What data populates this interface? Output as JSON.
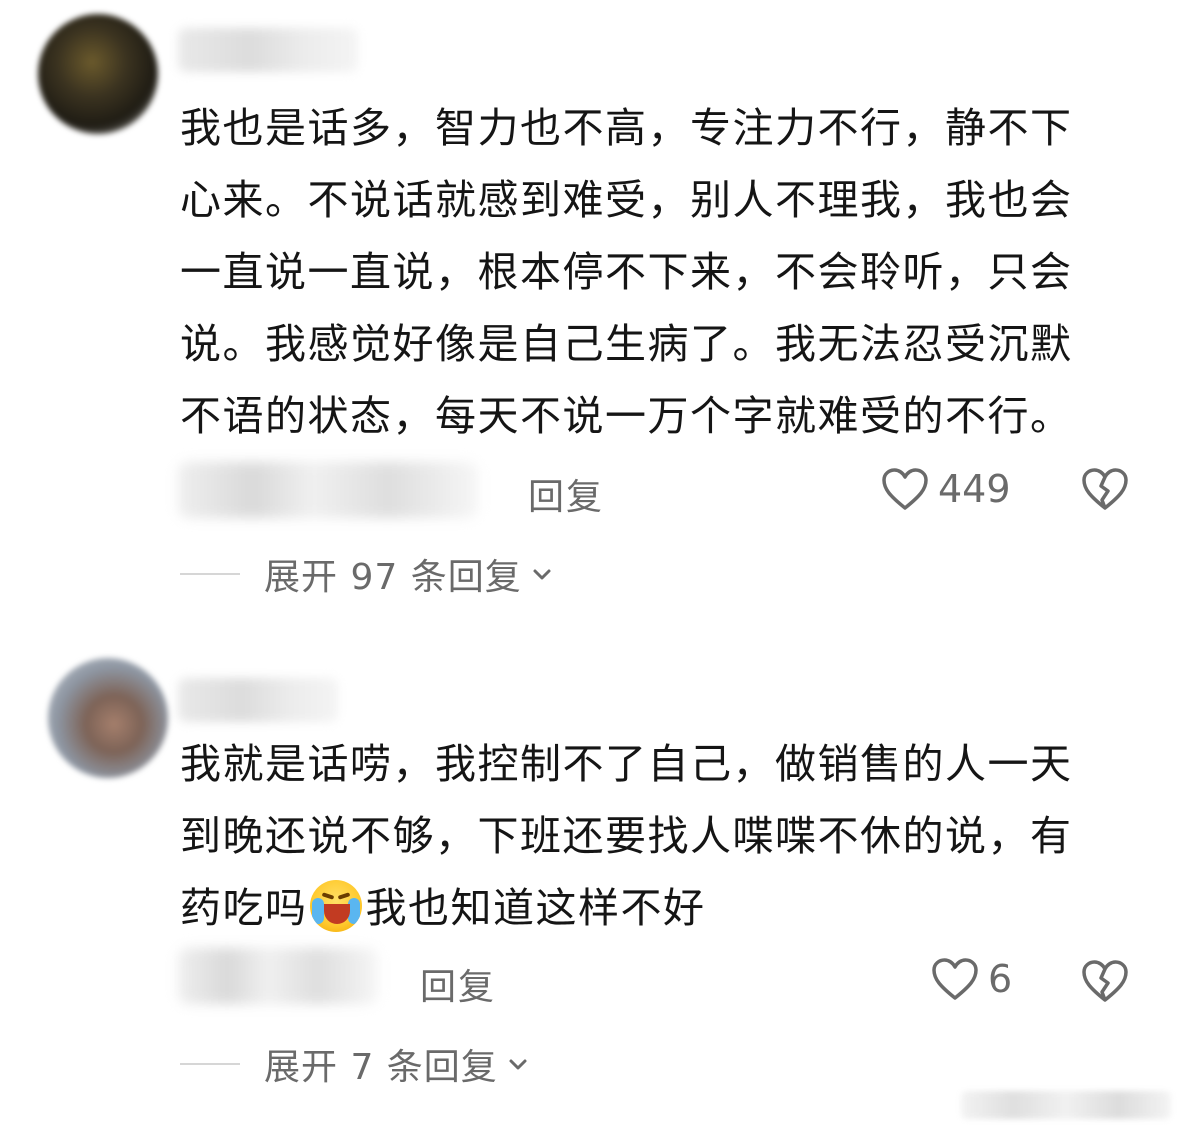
{
  "comments": [
    {
      "text": "我也是话多，智力也不高，专注力不行，静不下心来。不说话就感到难受，别人不理我，我也会一直说一直说，根本停不下来，不会聆听，只会说。我感觉好像是自己生病了。我无法忍受沉默不语的状态，每天不说一万个字就难受的不行。",
      "reply_label": "回复",
      "like_count": "449",
      "expand_label": "展开 97 条回复"
    },
    {
      "text_before_emoji": "我就是话唠，我控制不了自己，做销售的人一天到晚还说不够，下班还要找人喋喋不休的说，有药吃吗",
      "emoji": "loudly-crying-face-emoji",
      "text_after_emoji": "我也知道这样不好",
      "reply_label": "回复",
      "like_count": "6",
      "expand_label": "展开 7 条回复"
    }
  ],
  "icons": {
    "like": "heart-outline-icon",
    "dislike": "broken-heart-icon",
    "expand": "chevron-down-icon"
  },
  "colors": {
    "text": "#151515",
    "secondary": "#6a6a6a"
  }
}
